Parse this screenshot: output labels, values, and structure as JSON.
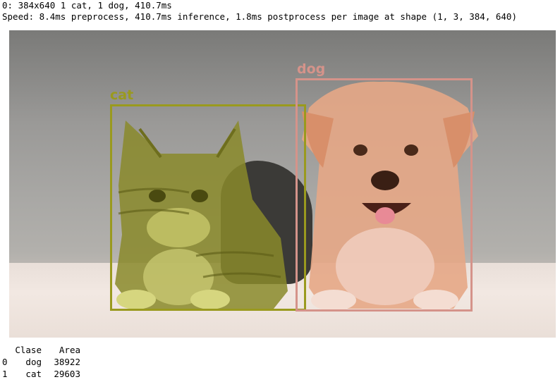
{
  "output": {
    "line1": "0: 384x640 1 cat, 1 dog, 410.7ms",
    "line2": "Speed: 8.4ms preprocess, 410.7ms inference, 1.8ms postprocess per image at shape (1, 3, 384, 640)"
  },
  "detections": {
    "cat": {
      "label": "cat",
      "color": "#9a9a1e"
    },
    "dog": {
      "label": "dog",
      "color": "#d5938a"
    }
  },
  "table": {
    "headers": {
      "class": "Clase",
      "area": "Area"
    },
    "rows": [
      {
        "index": "0",
        "class": "dog",
        "area": "38922"
      },
      {
        "index": "1",
        "class": "cat",
        "area": "29603"
      }
    ]
  }
}
